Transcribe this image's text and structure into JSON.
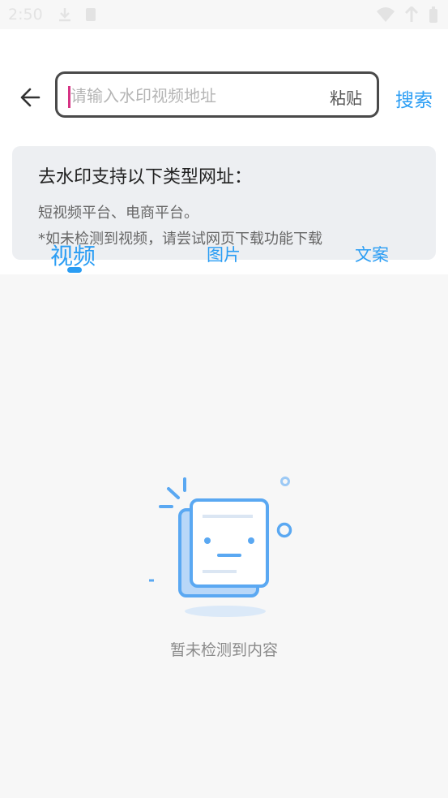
{
  "status_bar": {
    "time": "2:50"
  },
  "header": {
    "search_placeholder": "请输入水印视频地址",
    "paste_label": "粘贴",
    "search_label": "搜索"
  },
  "info": {
    "title": "去水印支持以下类型网址：",
    "line1": "短视频平台、电商平台。",
    "line2": "*如未检测到视频，请尝试网页下载功能下载"
  },
  "tabs": [
    {
      "label": "视频",
      "active": true
    },
    {
      "label": "图片",
      "active": false
    },
    {
      "label": "文案",
      "active": false
    }
  ],
  "empty_state": {
    "message": "暂未检测到内容"
  },
  "colors": {
    "accent": "#2a9df4",
    "illustration": "#5aa8f2"
  }
}
